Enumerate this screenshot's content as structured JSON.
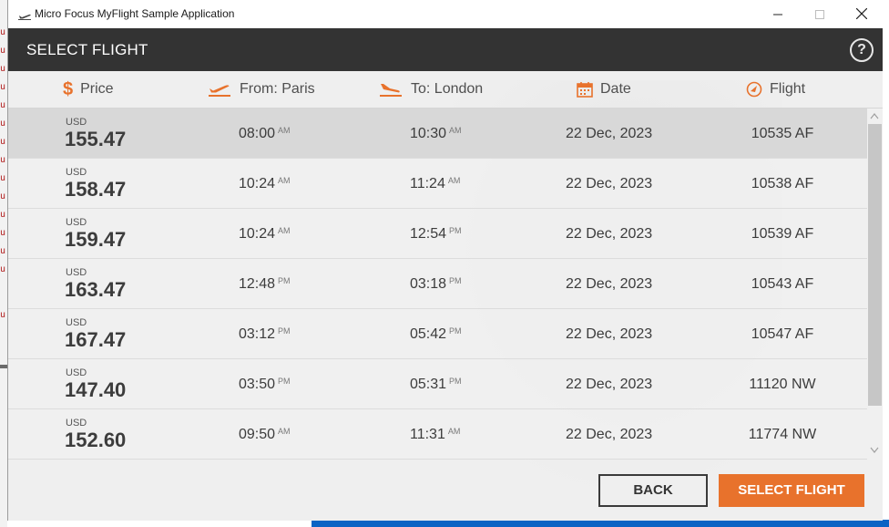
{
  "window": {
    "title": "Micro Focus MyFlight Sample Application"
  },
  "header": {
    "title": "SELECT FLIGHT",
    "help_label": "?"
  },
  "columns": {
    "price": {
      "icon_text": "$",
      "label": "Price"
    },
    "from": {
      "label": "From: Paris"
    },
    "to": {
      "label": "To: London"
    },
    "date": {
      "label": "Date"
    },
    "flight": {
      "label": "Flight"
    }
  },
  "flights": [
    {
      "currency": "USD",
      "price": "155.47",
      "dep_time": "08:00",
      "dep_ampm": "AM",
      "arr_time": "10:30",
      "arr_ampm": "AM",
      "date": "22 Dec, 2023",
      "flight": "10535 AF"
    },
    {
      "currency": "USD",
      "price": "158.47",
      "dep_time": "10:24",
      "dep_ampm": "AM",
      "arr_time": "11:24",
      "arr_ampm": "AM",
      "date": "22 Dec, 2023",
      "flight": "10538 AF"
    },
    {
      "currency": "USD",
      "price": "159.47",
      "dep_time": "10:24",
      "dep_ampm": "AM",
      "arr_time": "12:54",
      "arr_ampm": "PM",
      "date": "22 Dec, 2023",
      "flight": "10539 AF"
    },
    {
      "currency": "USD",
      "price": "163.47",
      "dep_time": "12:48",
      "dep_ampm": "PM",
      "arr_time": "03:18",
      "arr_ampm": "PM",
      "date": "22 Dec, 2023",
      "flight": "10543 AF"
    },
    {
      "currency": "USD",
      "price": "167.47",
      "dep_time": "03:12",
      "dep_ampm": "PM",
      "arr_time": "05:42",
      "arr_ampm": "PM",
      "date": "22 Dec, 2023",
      "flight": "10547 AF"
    },
    {
      "currency": "USD",
      "price": "147.40",
      "dep_time": "03:50",
      "dep_ampm": "PM",
      "arr_time": "05:31",
      "arr_ampm": "PM",
      "date": "22 Dec, 2023",
      "flight": "11120 NW"
    },
    {
      "currency": "USD",
      "price": "152.60",
      "dep_time": "09:50",
      "dep_ampm": "AM",
      "arr_time": "11:31",
      "arr_ampm": "AM",
      "date": "22 Dec, 2023",
      "flight": "11774 NW"
    }
  ],
  "actions": {
    "back": "BACK",
    "select": "SELECT FLIGHT"
  },
  "colors": {
    "accent": "#e8722c",
    "header_bg": "#333333"
  },
  "icons": [
    "plane-app-icon",
    "minimize-icon",
    "maximize-icon",
    "close-icon",
    "help-icon",
    "dollar-icon",
    "takeoff-icon",
    "landing-icon",
    "calendar-icon",
    "flight-compass-icon"
  ]
}
